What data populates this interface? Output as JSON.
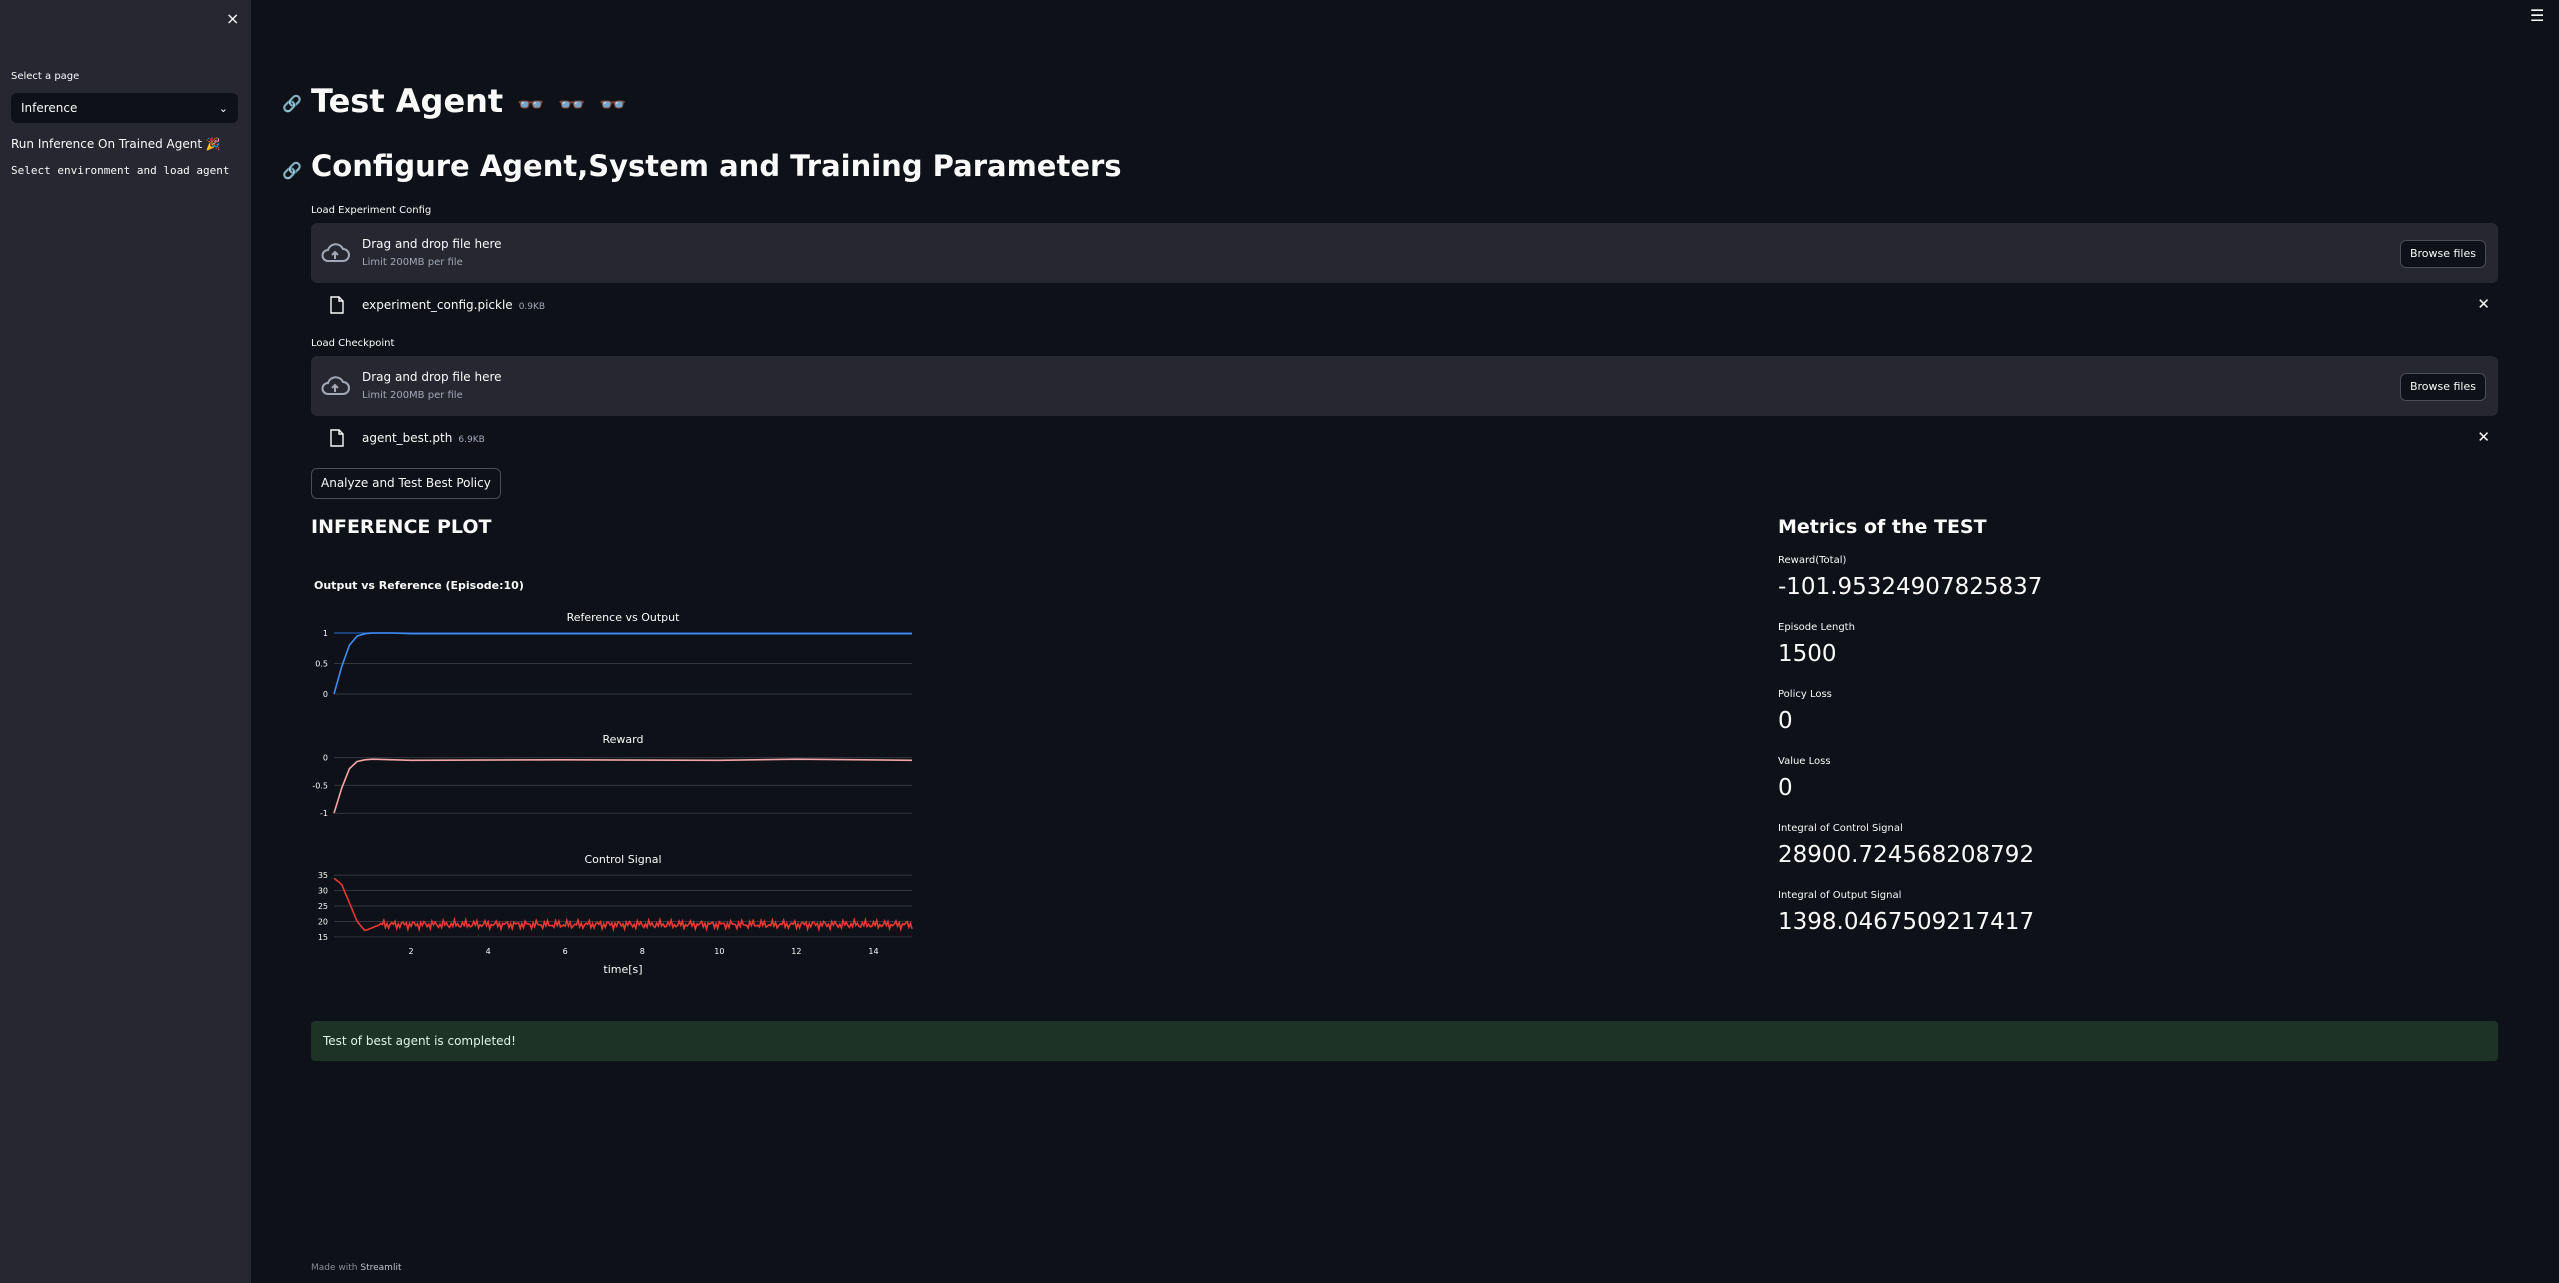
{
  "sidebar": {
    "close_icon": "×",
    "select_label": "Select a page",
    "selected_page": "Inference",
    "run_text": "Run Inference On Trained Agent 🎉",
    "select_env_text": "Select environment and load agent"
  },
  "header": {
    "menu_icon": "☰",
    "title": "Test Agent",
    "title_emojis": "👓 👓 👓"
  },
  "config": {
    "heading": "Configure Agent,System and Training Parameters",
    "uploaders": [
      {
        "label": "Load Experiment Config",
        "drop_text": "Drag and drop file here",
        "limit_text": "Limit 200MB per file",
        "browse_label": "Browse files",
        "file_name": "experiment_config.pickle",
        "file_size": "0.9KB"
      },
      {
        "label": "Load Checkpoint",
        "drop_text": "Drag and drop file here",
        "limit_text": "Limit 200MB per file",
        "browse_label": "Browse files",
        "file_name": "agent_best.pth",
        "file_size": "6.9KB"
      }
    ],
    "analyze_button": "Analyze and Test Best Policy"
  },
  "inference": {
    "heading": "INFERENCE PLOT",
    "chart_title": "Output vs Reference (Episode:10)"
  },
  "chart_data": {
    "type": "line",
    "title": "Output vs Reference (Episode:10)",
    "xlabel": "time[s]",
    "xlim": [
      0,
      15
    ],
    "x_ticks": [
      2,
      4,
      6,
      8,
      10,
      12,
      14
    ],
    "grid": true,
    "subplots": [
      {
        "title": "Reference vs Output",
        "ylim": [
          0,
          1.05
        ],
        "y_ticks": [
          "0",
          "0.5",
          "1"
        ],
        "series": [
          {
            "color": "#1f4e9c",
            "x": [
              0,
              15
            ],
            "y": [
              1,
              1
            ]
          },
          {
            "color": "#3d8ef0",
            "x": [
              0,
              0.2,
              0.4,
              0.6,
              0.8,
              1.0,
              1.5,
              2,
              15
            ],
            "y": [
              0,
              0.45,
              0.8,
              0.95,
              0.99,
              1.0,
              1.0,
              0.99,
              0.99
            ]
          }
        ]
      },
      {
        "title": "Reward",
        "ylim": [
          -1.05,
          0.1
        ],
        "y_ticks": [
          "0",
          "-0.5",
          "-1"
        ],
        "series": [
          {
            "color": "#f4a6a6",
            "x": [
              0,
              0.2,
              0.4,
              0.6,
              0.8,
              1.0,
              2,
              6,
              10,
              12,
              15
            ],
            "y": [
              -1,
              -0.55,
              -0.2,
              -0.07,
              -0.04,
              -0.03,
              -0.05,
              -0.04,
              -0.05,
              -0.03,
              -0.05
            ]
          }
        ]
      },
      {
        "title": "Control Signal",
        "ylim": [
          14,
          36
        ],
        "y_ticks": [
          "35",
          "30",
          "25",
          "20",
          "15"
        ],
        "series": [
          {
            "color": "#e53935",
            "noisy": true,
            "x": [
              0,
              0.2,
              0.4,
              0.6,
              0.8,
              1.0,
              1.2,
              15
            ],
            "y": [
              34,
              32,
              26,
              20,
              17,
              18,
              19,
              19
            ]
          }
        ]
      }
    ]
  },
  "metrics": {
    "heading": "Metrics of the TEST",
    "items": [
      {
        "label": "Reward(Total)",
        "value": "-101.95324907825837"
      },
      {
        "label": "Episode Length",
        "value": "1500"
      },
      {
        "label": "Policy Loss",
        "value": "0"
      },
      {
        "label": "Value Loss",
        "value": "0"
      },
      {
        "label": "Integral of Control Signal",
        "value": "28900.724568208792"
      },
      {
        "label": "Integral of Output Signal",
        "value": "1398.0467509217417"
      }
    ]
  },
  "status": {
    "success_text": "Test of best agent is completed!"
  },
  "footer": {
    "made_with": "Made with",
    "link": "Streamlit"
  }
}
